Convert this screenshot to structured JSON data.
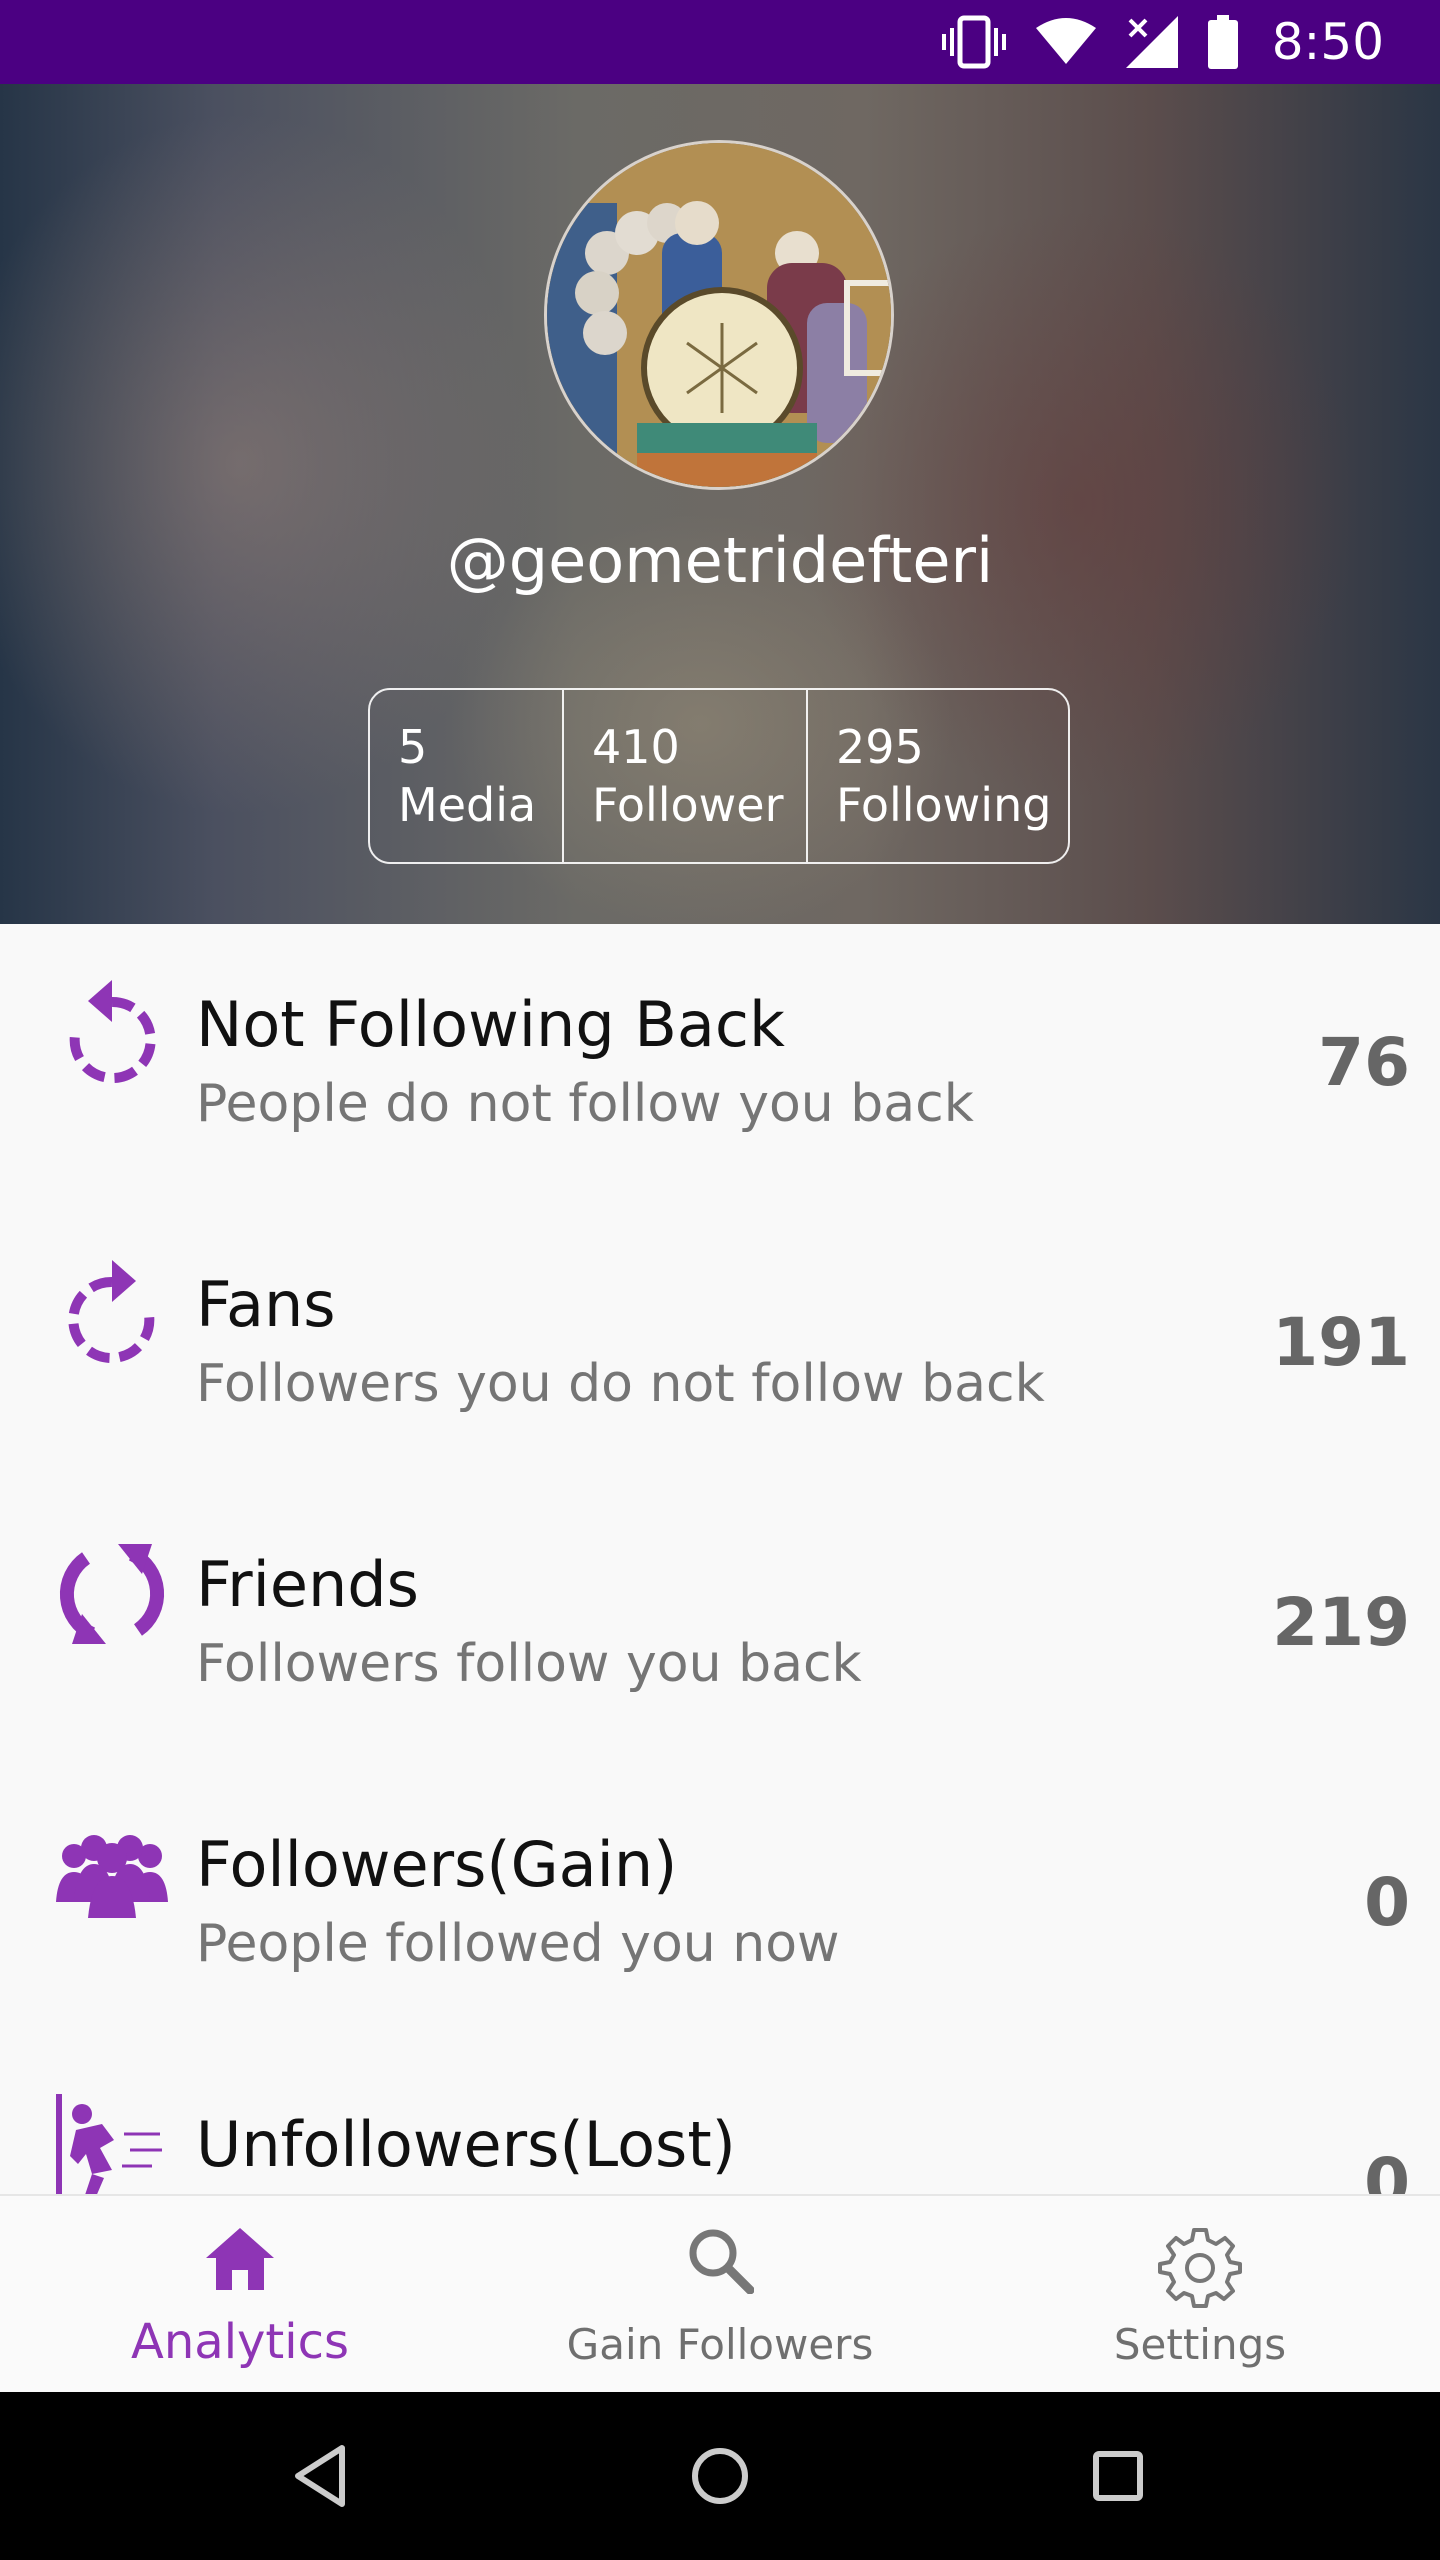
{
  "status_bar": {
    "time": "8:50",
    "icons": [
      "vibrate-icon",
      "wifi-icon",
      "signal-icon",
      "battery-icon"
    ],
    "background": "#4b0082"
  },
  "profile": {
    "username": "@geometridefteri",
    "stats": [
      {
        "value": "5",
        "label": "Media"
      },
      {
        "value": "410",
        "label": "Follower"
      },
      {
        "value": "295",
        "label": "Following"
      }
    ]
  },
  "list": {
    "accent_color": "#8e35b5",
    "items": [
      {
        "title": "Not Following Back",
        "subtitle": "People do not follow you back",
        "count": "76",
        "icon": "reload-ccw-icon"
      },
      {
        "title": "Fans",
        "subtitle": "Followers you do not follow back",
        "count": "191",
        "icon": "reload-cw-icon"
      },
      {
        "title": "Friends",
        "subtitle": "Followers follow you back",
        "count": "219",
        "icon": "sync-icon"
      },
      {
        "title": "Followers(Gain)",
        "subtitle": "People followed you now",
        "count": "0",
        "icon": "group-icon"
      },
      {
        "title": "Unfollowers(Lost)",
        "subtitle": "",
        "count": "0",
        "icon": "running-man-icon"
      }
    ]
  },
  "bottom_nav": {
    "items": [
      {
        "label": "Analytics",
        "icon": "home-icon",
        "active": true
      },
      {
        "label": "Gain Followers",
        "icon": "search-icon",
        "active": false
      },
      {
        "label": "Settings",
        "icon": "gear-icon",
        "active": false
      }
    ]
  },
  "system_nav": {
    "buttons": [
      "back-icon",
      "home-circle-icon",
      "recents-icon"
    ]
  }
}
